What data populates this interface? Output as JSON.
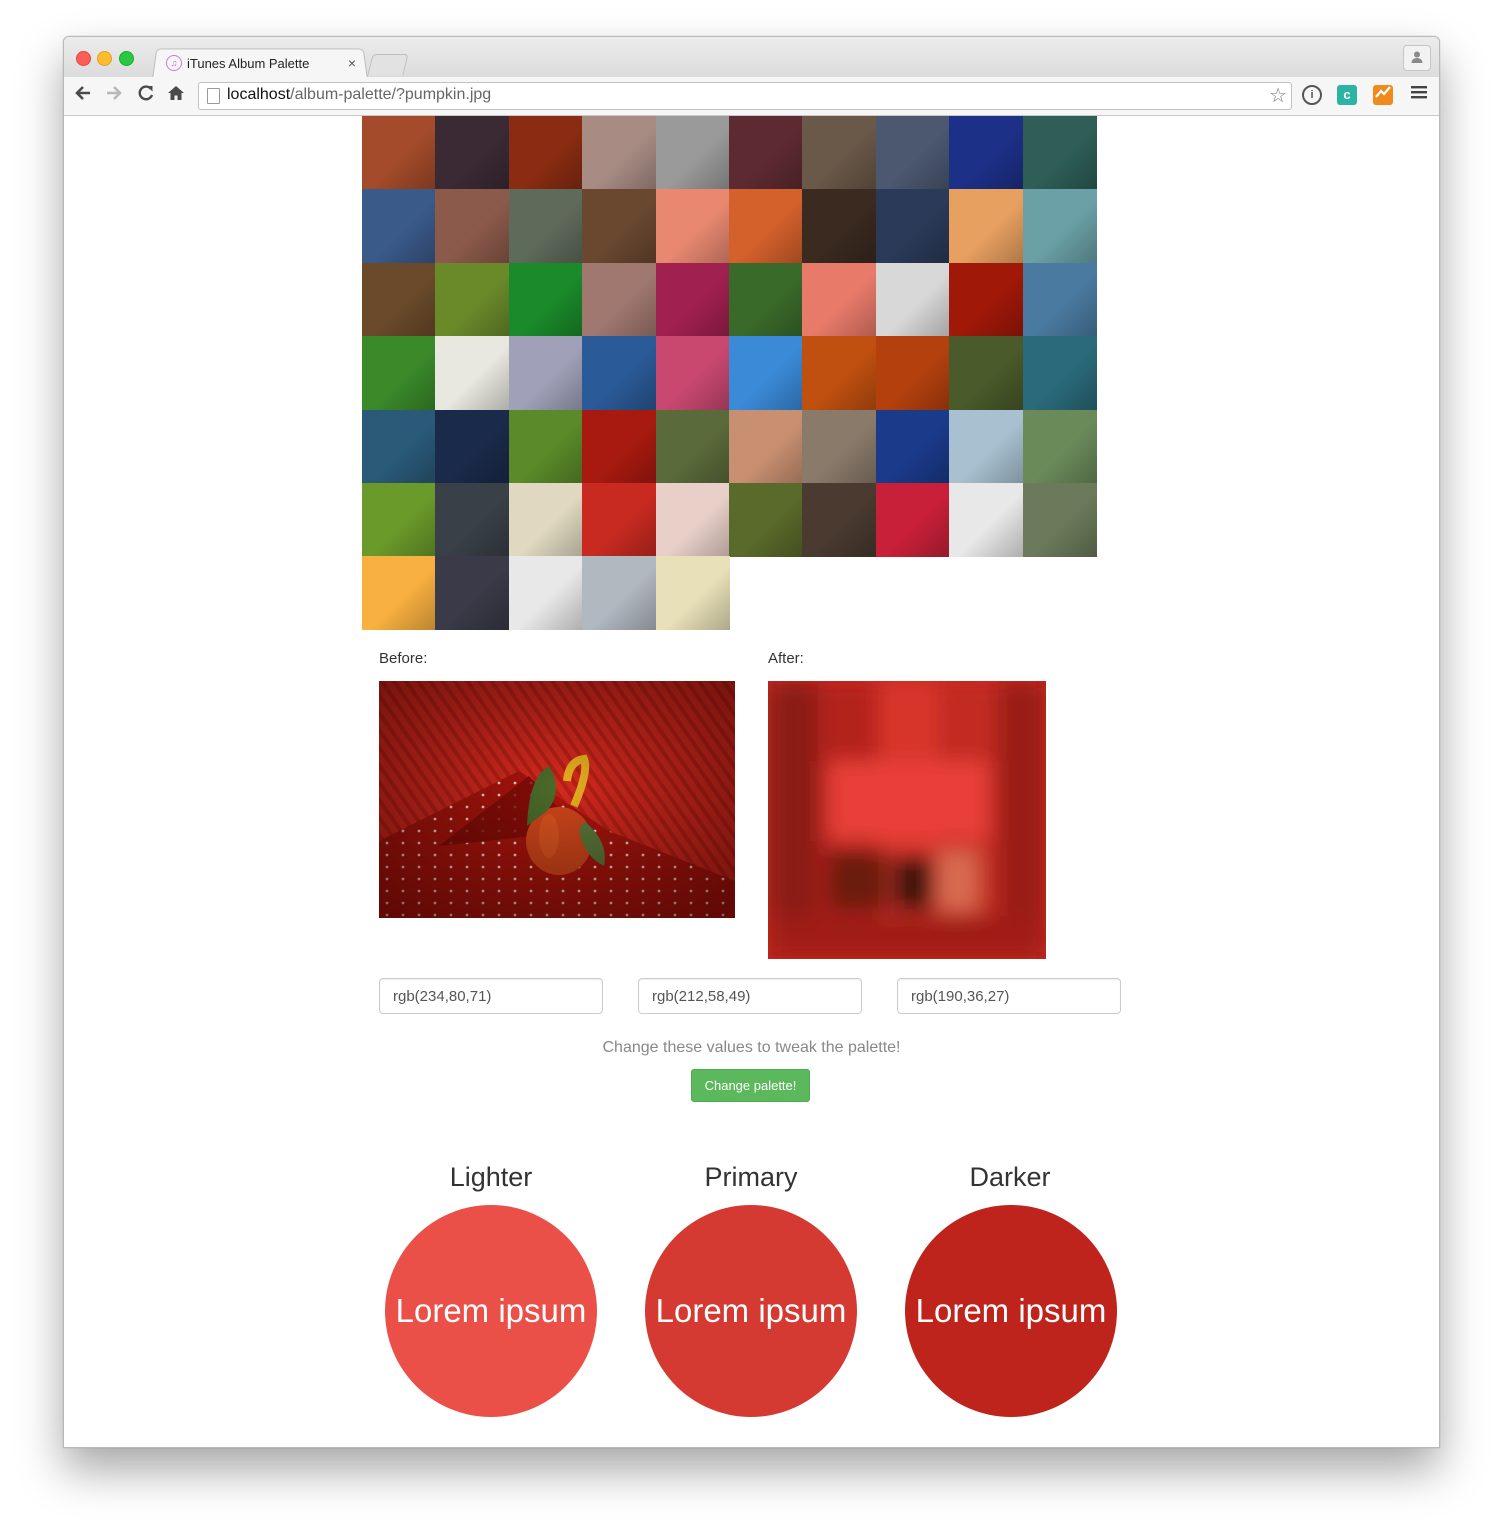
{
  "browser": {
    "tab_title": "iTunes Album Palette",
    "tab_close": "×",
    "url_host": "localhost",
    "url_path": "/album-palette/?pumpkin.jpg"
  },
  "grid": {
    "thumbnails": [
      [
        "#a34b2a",
        "#3b2a34",
        "#8a2c12",
        "#a88c84",
        "#9a9a9a",
        "#5e2a32",
        "#6a5848",
        "#4b5870",
        "#1d3088",
        "#2e5e56"
      ],
      [
        "#3a5a8a",
        "#8c5a4a",
        "#5e6a5a",
        "#6a4830",
        "#e88870",
        "#d4602c",
        "#3a2a20",
        "#2a3a58",
        "#e8a060",
        "#6aa0a6"
      ],
      [
        "#6a4a2a",
        "#6a8a2a",
        "#1a8a2a",
        "#a07870",
        "#a02050",
        "#3a6a2a",
        "#e87a6a",
        "#d8d8d8",
        "#a01808",
        "#4a7aa0"
      ],
      [
        "#3a8a2a",
        "#e8e8e0",
        "#a0a0b8",
        "#2a5a98",
        "#c84870",
        "#3a8ad8",
        "#c05010",
        "#b4400e",
        "#4a5a2a",
        "#2a6a7a"
      ],
      [
        "#2a5a78",
        "#1a2a4a",
        "#5a8a2a",
        "#a81a10",
        "#5a6a3a",
        "#c89070",
        "#8a7a6a",
        "#1a3a8a",
        "#a8c0d0",
        "#6a8a5a"
      ],
      [
        "#6a9a2a",
        "#3a4048",
        "#e0d8c0",
        "#c82a20",
        "#e8d0c8",
        "#5a6a2a",
        "#4a3a30",
        "#c82038",
        "#e8e8e8",
        "#6a7a5a"
      ],
      [
        "#f8b040",
        "#3a3a48",
        "#e8e8e8",
        "#b0b8c0",
        "#e8e0b8"
      ]
    ]
  },
  "comparison": {
    "before_label": "Before:",
    "after_label": "After:"
  },
  "palette_inputs": {
    "lighter_value": "rgb(234,80,71)",
    "primary_value": "rgb(212,58,49)",
    "darker_value": "rgb(190,36,27)"
  },
  "hint": "Change these values to tweak the palette!",
  "change_button": "Change palette!",
  "swatches": {
    "lighter": {
      "title": "Lighter",
      "text": "Lorem ipsum",
      "color": "#ea5047"
    },
    "primary": {
      "title": "Primary",
      "text": "Lorem ipsum",
      "color": "#d43a31"
    },
    "darker": {
      "title": "Darker",
      "text": "Lorem ipsum",
      "color": "#be241b"
    }
  },
  "colors": {
    "button_green": "#5cb85c",
    "tab_active": "#f6f6f6"
  }
}
